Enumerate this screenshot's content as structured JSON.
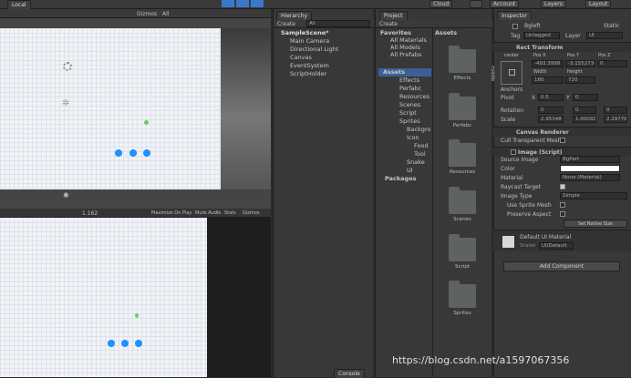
{
  "toolbar": {
    "scene_tab": "Local",
    "cloud_label": "Cloud",
    "account_label": "Account",
    "layers_label": "Layers",
    "layout_label": "Layout"
  },
  "scene_view": {
    "gizmos_label": "Gizmos",
    "all_label": "All"
  },
  "game_view": {
    "scale_label": "1.162",
    "maximize_label": "Maximize On Play",
    "mute_label": "Mute Audio",
    "stats_label": "Stats",
    "gizmos_label": "Gizmos"
  },
  "hierarchy": {
    "tab": "Hierarchy",
    "create": "Create",
    "search_placeholder": "All",
    "scene_name": "SampleScene*",
    "items": [
      "Main Camera",
      "Directional Light",
      "Canvas",
      "EventSystem",
      "ScriptHolder"
    ]
  },
  "project": {
    "tab": "Project",
    "create": "Create",
    "favorites_label": "Favorites",
    "favorites": [
      "All Materials",
      "All Models",
      "All Prefabs"
    ],
    "assets_label": "Assets",
    "tree": [
      "Effects",
      "Perfabc",
      "Resources",
      "Scenes",
      "Script",
      "Sprites",
      "Backgro",
      "Icon",
      "Food",
      "Tool",
      "Snake",
      "UI"
    ],
    "packages_label": "Packages",
    "grid_header": "Assets",
    "folders": [
      "Effects",
      "Perfabc",
      "Resources",
      "Scenes",
      "Script",
      "Sprites"
    ]
  },
  "console_tab": "Console",
  "inspector": {
    "tab": "Inspector",
    "object_name": "Bgleft",
    "static_label": "Static",
    "tag_label": "Tag",
    "tag_value": "Untagged",
    "layer_label": "Layer",
    "layer_value": "UI",
    "rect_transform": "Rect Transform",
    "anchor_label": "center",
    "middle_label": "middle",
    "pos_x_label": "Pos X",
    "pos_y_label": "Pos Y",
    "pos_z_label": "Pos Z",
    "pos_x": "-493.3998",
    "pos_y": "-3.155273e",
    "pos_z": "0",
    "width_label": "Width",
    "height_label": "Height",
    "width": "180",
    "height": "720",
    "anchors_label": "Anchors",
    "pivot_label": "Pivot",
    "pivot_x": "0.5",
    "pivot_y": "0",
    "rotation_label": "Rotation",
    "rot_x": "0",
    "rot_y": "0",
    "rot_z": "0",
    "scale_label": "Scale",
    "scale_x": "2.95348",
    "scale_y": "1.00092",
    "scale_z": "2.29776",
    "canvas_renderer": "Canvas Renderer",
    "cull_label": "Cull Transparent Mesh",
    "image_script": "Image (Script)",
    "source_image_label": "Source Image",
    "source_image_value": "BgPart",
    "color_label": "Color",
    "material_label": "Material",
    "material_value": "None (Material)",
    "raycast_label": "Raycast Target",
    "image_type_label": "Image Type",
    "image_type_value": "Simple",
    "use_sprite_mesh_label": "Use Sprite Mesh",
    "preserve_aspect_label": "Preserve Aspect",
    "set_native_label": "Set Native Size",
    "material_name": "Default UI Material",
    "shader_label": "Shader",
    "shader_value": "UI/Default",
    "add_component": "Add Component"
  },
  "watermark": "https://blog.csdn.net/a1597067356",
  "colors": {
    "accent": "#1e90ff",
    "selection": "#3e5f96",
    "panel": "#383838"
  }
}
